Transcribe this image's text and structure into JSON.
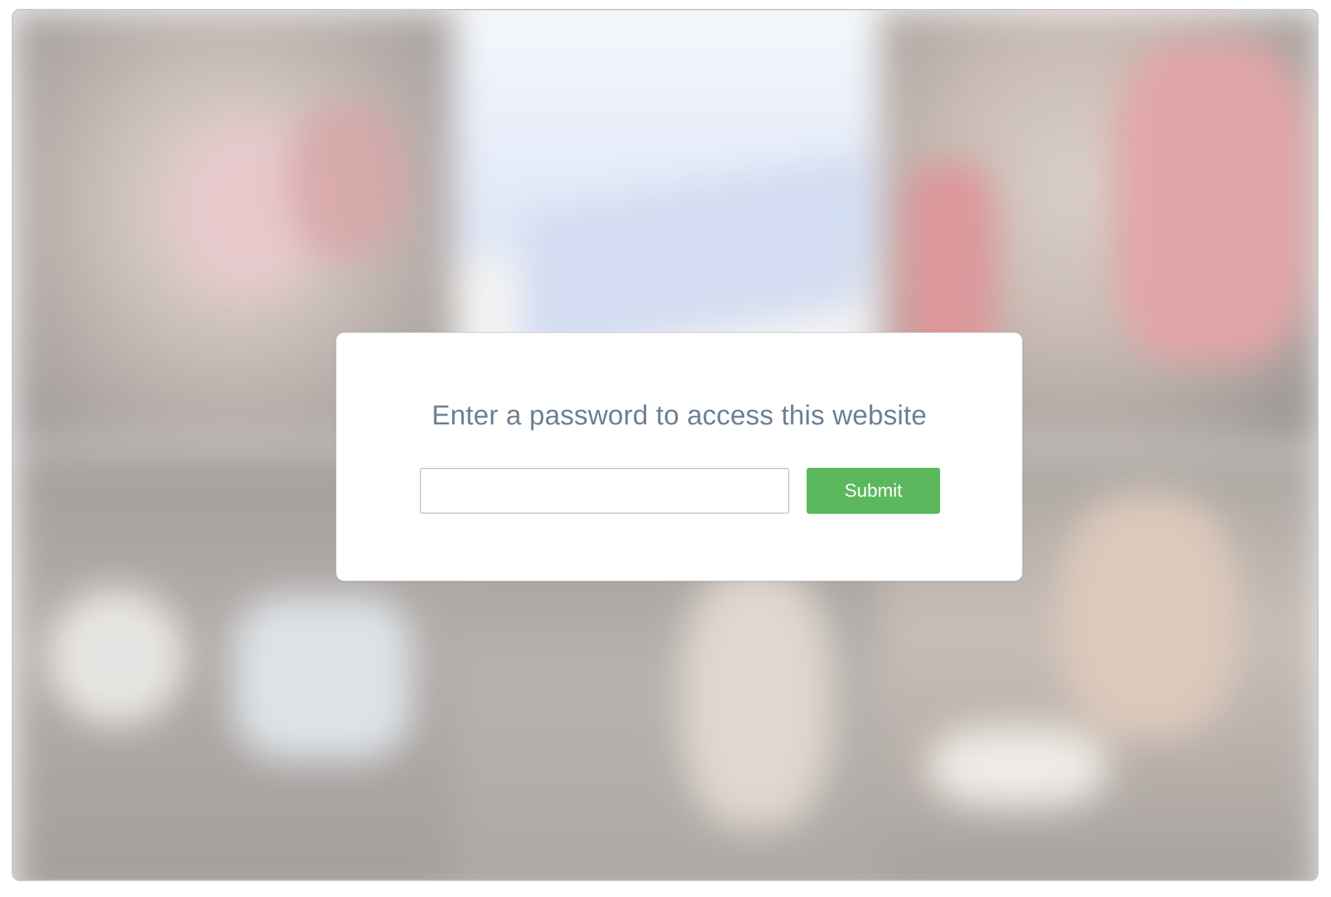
{
  "prompt": {
    "title": "Enter a password to access this website",
    "password_value": "",
    "password_placeholder": "",
    "submit_label": "Submit"
  },
  "colors": {
    "submit_bg": "#5cb85c",
    "title_text": "#6e8092",
    "card_bg": "#ffffff"
  }
}
